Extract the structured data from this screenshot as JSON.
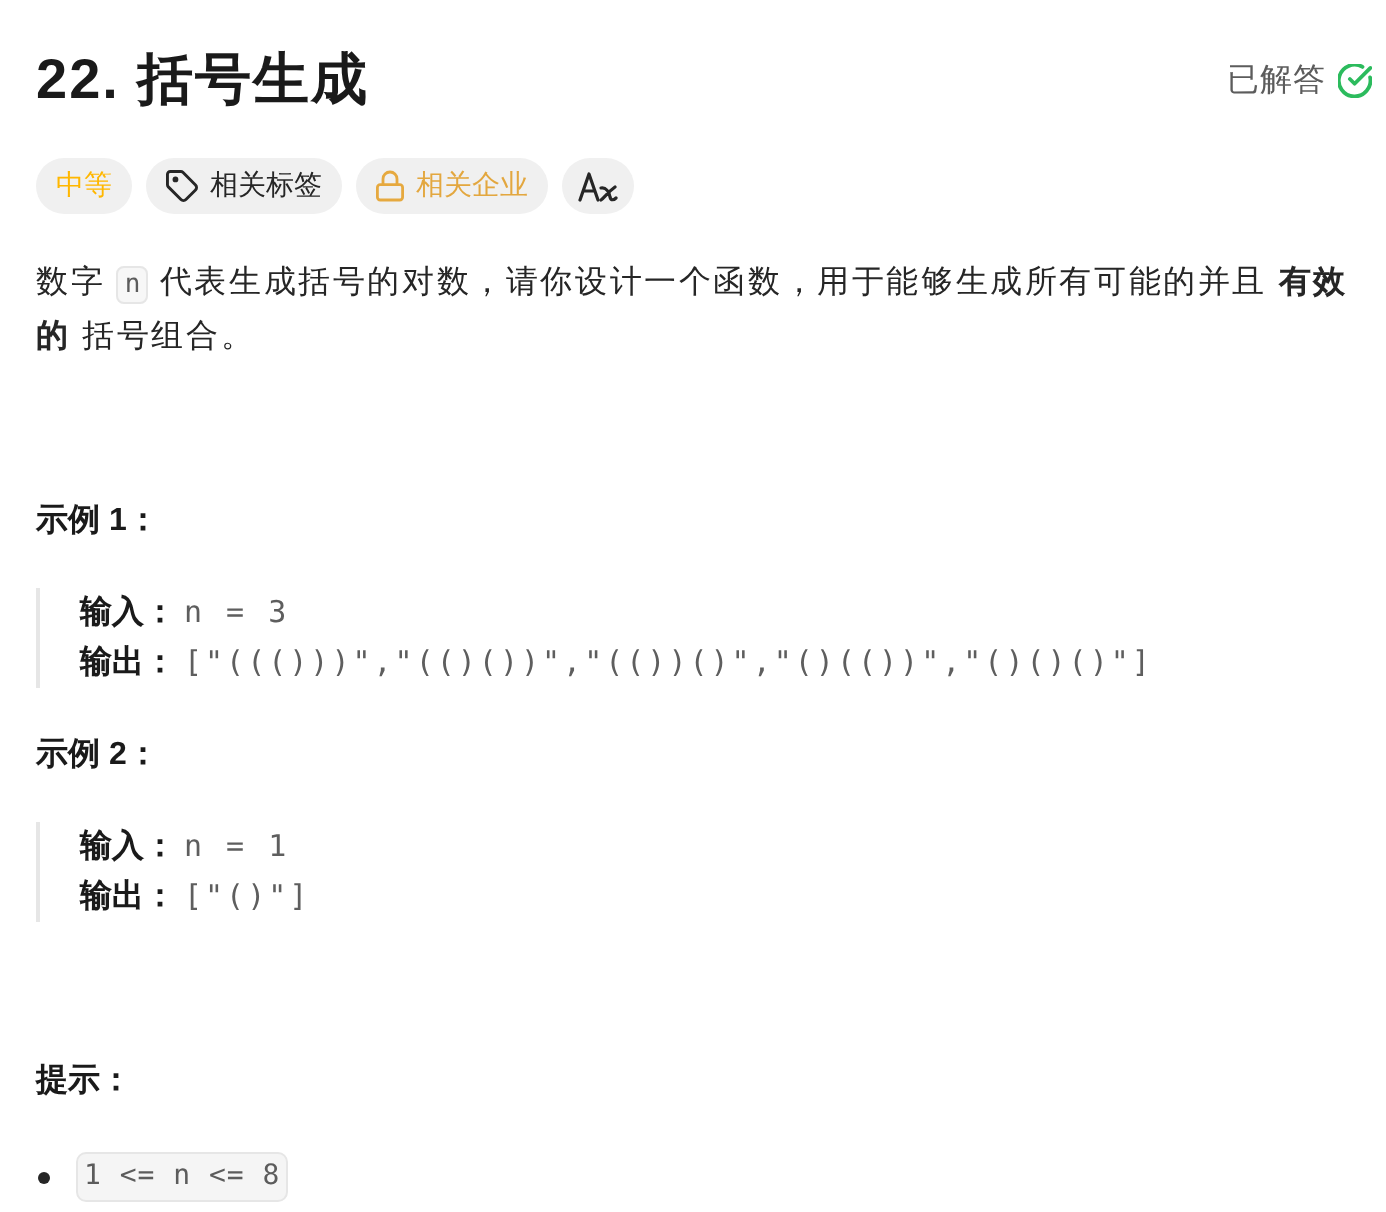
{
  "title": "22. 括号生成",
  "status": {
    "label": "已解答",
    "solved": true
  },
  "tags": [
    {
      "kind": "difficulty",
      "label": "中等"
    },
    {
      "kind": "topics",
      "label": "相关标签"
    },
    {
      "kind": "companies",
      "label": "相关企业"
    },
    {
      "kind": "translate"
    }
  ],
  "description": [
    {
      "kind": "text",
      "text": "数字 "
    },
    {
      "kind": "code",
      "text": "n"
    },
    {
      "kind": "text",
      "text": " 代表生成括号的对数，请你设计一个函数，用于能够生成所有可能的并且 "
    },
    {
      "kind": "bold",
      "text": "有效的"
    },
    {
      "kind": "text",
      "text": " 括号组合。"
    }
  ],
  "examples": [
    {
      "title": "示例 1：",
      "lines": [
        {
          "label": "输入：",
          "value": "n = 3"
        },
        {
          "label": "输出：",
          "value": "[\"((()))\",\"(()())\",\"(())()\",\"()(())\",\"()()()\"]"
        }
      ]
    },
    {
      "title": "示例 2：",
      "lines": [
        {
          "label": "输入：",
          "value": "n = 1"
        },
        {
          "label": "输出：",
          "value": "[\"()\"]"
        }
      ]
    }
  ],
  "constraints": {
    "title": "提示：",
    "items": [
      "1 <= n <= 8"
    ]
  }
}
